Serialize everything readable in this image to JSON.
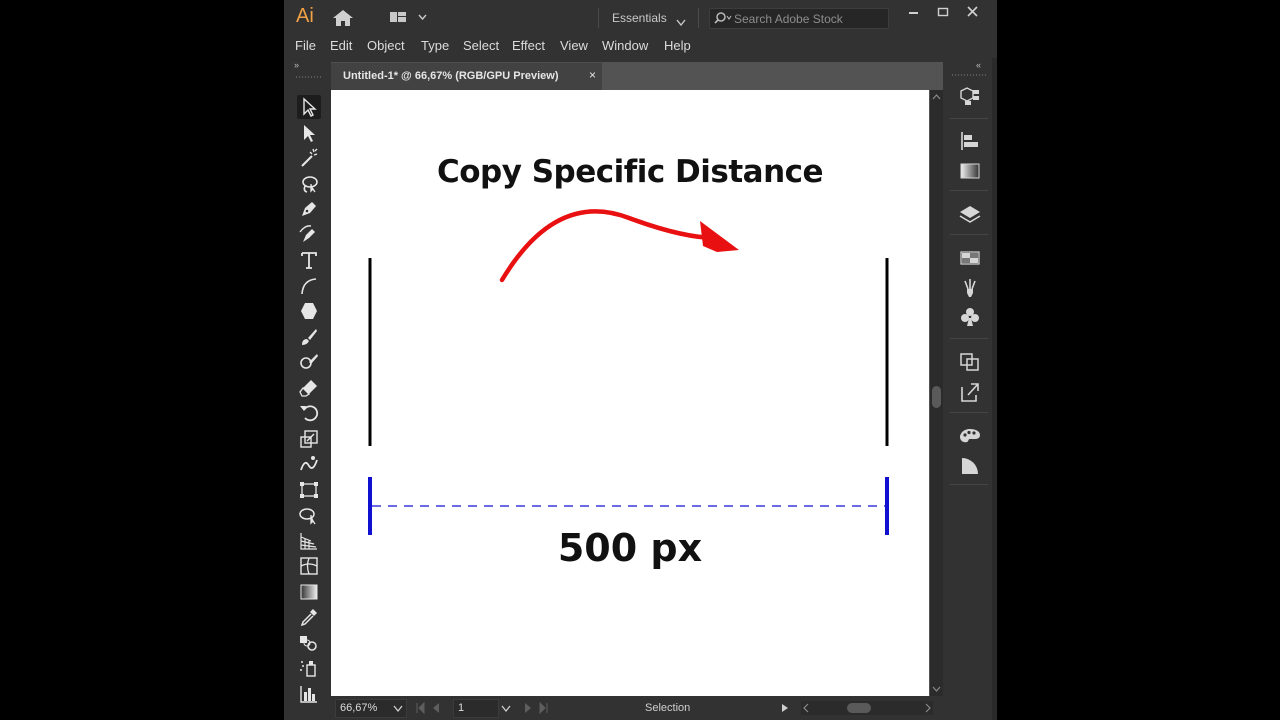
{
  "app": {
    "logo": "Ai",
    "workspace": "Essentials",
    "stock_search_placeholder": "Search Adobe Stock"
  },
  "menu": [
    "File",
    "Edit",
    "Object",
    "Type",
    "Select",
    "Effect",
    "View",
    "Window",
    "Help"
  ],
  "document": {
    "tab_title": "Untitled-1* @ 66,67% (RGB/GPU Preview)",
    "close_glyph": "×"
  },
  "artwork": {
    "title": "Copy Specific Distance",
    "distance_label": "500 px",
    "arrow_color": "#e81010",
    "measure_color": "#1010d0",
    "line_color": "#000000"
  },
  "status": {
    "zoom": "66,67%",
    "artboard": "1",
    "tool": "Selection"
  },
  "toolbar": {
    "collapse_left": "»",
    "collapse_right": "«"
  }
}
